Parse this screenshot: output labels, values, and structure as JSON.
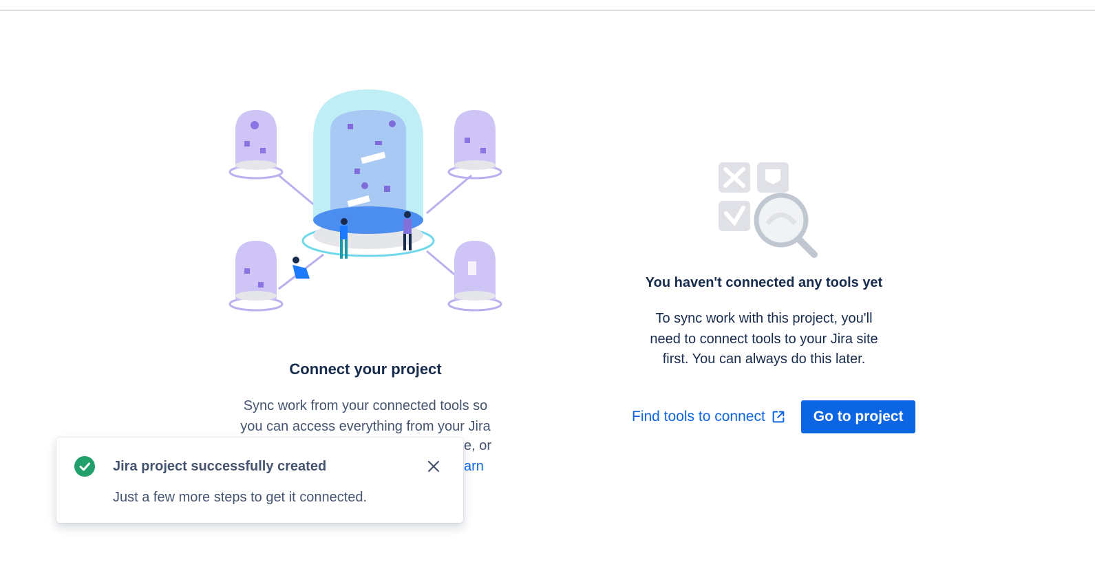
{
  "left": {
    "title": "Connect your project",
    "description_visible": "Sync work from your connected tools so you can access everything from your Jira",
    "description_tail": "e, or",
    "learn_link": "arn"
  },
  "right": {
    "title": "You haven't connected any tools yet",
    "description": "To sync work with this project, you'll need to connect tools to your Jira site first. You can always do this later.",
    "find_tools_label": "Find tools to connect",
    "go_to_project_label": "Go to project"
  },
  "toast": {
    "title": "Jira project successfully created",
    "body": "Just a few more steps to get it connected."
  },
  "colors": {
    "brand_blue": "#0c66e4",
    "success_green": "#22a06b",
    "text_dark": "#172b4d",
    "text_subtle": "#44546f"
  }
}
